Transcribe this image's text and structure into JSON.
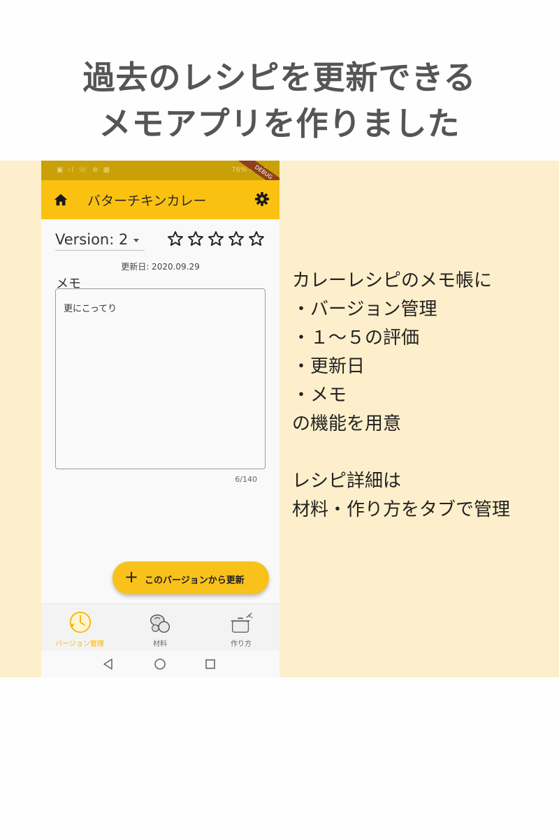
{
  "headline": {
    "line1": "過去のレシピを更新できる",
    "line2": "メモアプリを作りました"
  },
  "phone": {
    "statusbar": {
      "left": "▣ ıl ☏ ⊗ ▦",
      "right": "76% ▭ 16",
      "debug_label": "DEBUG"
    },
    "appbar": {
      "title": "バターチキンカレー",
      "home_icon": "home-icon",
      "settings_icon": "gear-icon"
    },
    "version_selector": {
      "value": "Version: 2"
    },
    "rating": {
      "max": 5,
      "value": 0
    },
    "updated_date": "更新日: 2020.09.29",
    "memo": {
      "label": "メモ",
      "value": "更にこってり",
      "counter": "6/140"
    },
    "fab": {
      "label": "このバージョンから更新",
      "icon": "plus-icon"
    },
    "bottom_nav": [
      {
        "label": "バージョン管理",
        "icon": "clock-icon",
        "active": true
      },
      {
        "label": "材料",
        "icon": "ingredients-icon",
        "active": false
      },
      {
        "label": "作り方",
        "icon": "cooking-pot-icon",
        "active": false
      }
    ],
    "system_nav": [
      "back-icon",
      "home-circle-icon",
      "recents-icon"
    ],
    "accent_color": "#fbc111"
  },
  "description": {
    "lines": [
      "カレーレシピのメモ帳に",
      "・バージョン管理",
      "・１～５の評価",
      "・更新日",
      "・メモ",
      "の機能を用意",
      "",
      "レシピ詳細は",
      "材料・作り方をタブで管理"
    ]
  },
  "colors": {
    "background_band": "#fdefcb",
    "headline_text": "#555555"
  }
}
